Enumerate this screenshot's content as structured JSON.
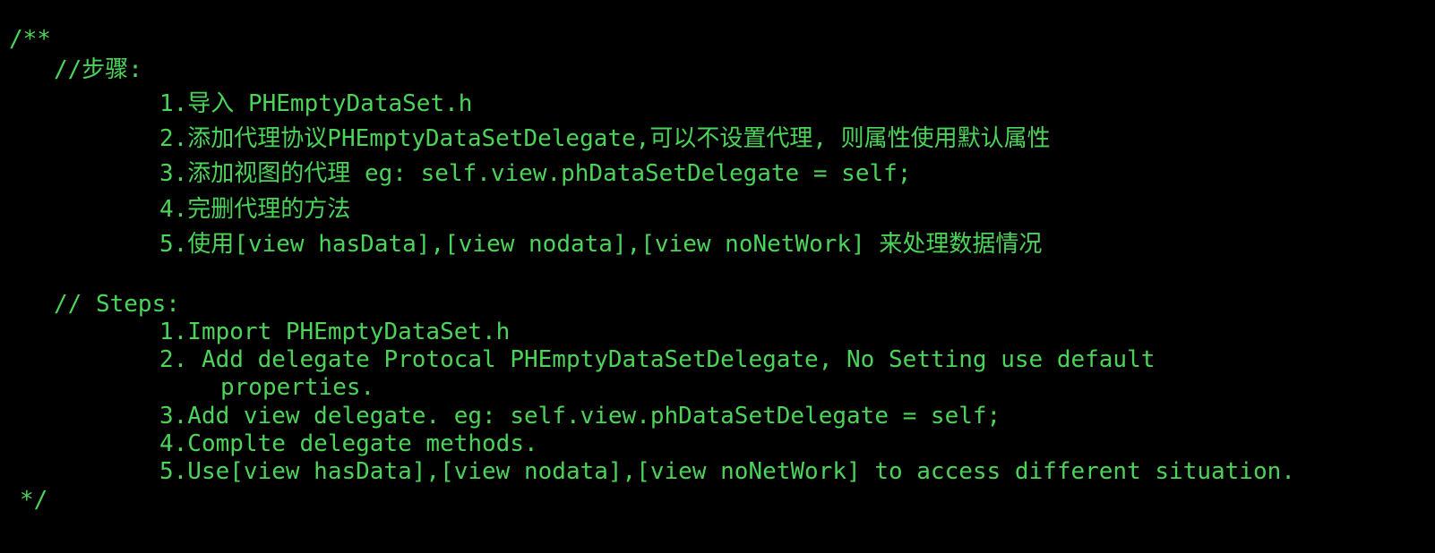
{
  "theme": {
    "background": "#000000",
    "text_color": "#4cd45a"
  },
  "code": {
    "comment_open": "/**",
    "zh_header": "//步骤:",
    "zh_steps": [
      "1.导入 PHEmptyDataSet.h",
      "2.添加代理协议PHEmptyDataSetDelegate,可以不设置代理, 则属性使用默认属性",
      "3.添加视图的代理 eg: self.view.phDataSetDelegate = self;",
      "4.完删代理的方法",
      "5.使用[view hasData],[view nodata],[view noNetWork] 来处理数据情况"
    ],
    "en_header": "// Steps:",
    "en_steps": [
      "1.Import PHEmptyDataSet.h",
      "2. Add delegate Protocal PHEmptyDataSetDelegate, No Setting use default",
      "properties.",
      "3.Add view delegate. eg: self.view.phDataSetDelegate = self;",
      "4.Complte delegate methods.",
      "5.Use[view hasData],[view nodata],[view noNetWork] to access different situation."
    ],
    "comment_close": "*/"
  }
}
